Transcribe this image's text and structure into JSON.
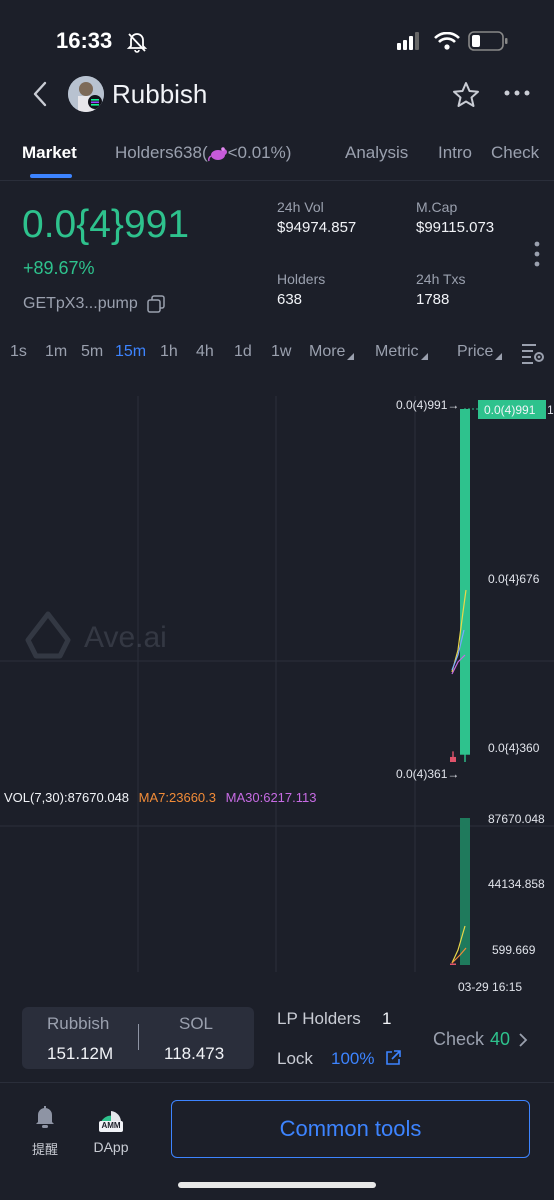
{
  "status_bar": {
    "time": "16:33"
  },
  "header": {
    "title": "Rubbish"
  },
  "tabs": [
    {
      "label": "Market"
    },
    {
      "label": "Holders638("
    },
    {
      "label": "<0.01%)"
    },
    {
      "label": "Analysis"
    },
    {
      "label": "Intro"
    },
    {
      "label": "Check"
    }
  ],
  "token": {
    "price": "0.0{4}991",
    "change": "+89.67%",
    "address": "GETpX3...pump"
  },
  "stats": {
    "vol_label": "24h Vol",
    "vol_value": "$94974.857",
    "mcap_label": "M.Cap",
    "mcap_value": "$99115.073",
    "holders_label": "Holders",
    "holders_value": "638",
    "txs_label": "24h Txs",
    "txs_value": "1788"
  },
  "timeframes": [
    "1s",
    "1m",
    "5m",
    "15m",
    "1h",
    "4h",
    "1d",
    "1w"
  ],
  "active_timeframe": "15m",
  "toolbar": {
    "more": "More",
    "metric": "Metric",
    "price": "Price"
  },
  "chart": {
    "watermark": "Ave.ai",
    "high_marker": "0.0(4)991→",
    "low_marker": "0.0(4)361→",
    "price_tag": "0.0(4)991",
    "price_tag_suffix": "1",
    "y_labels": [
      "0.0{4}676",
      "0.0{4}360"
    ],
    "vol_info": "VOL(7,30):87670.048",
    "ma7": "MA7:23660.3",
    "ma30": "MA30:6217.113",
    "vol_labels": [
      "87670.048",
      "44134.858",
      "599.669"
    ],
    "x_label": "03-29 16:15",
    "colors": {
      "up": "#2ec28d",
      "down": "#e0536b",
      "ma7": "#f28c38",
      "ma30": "#c66be3"
    }
  },
  "chart_data": {
    "type": "candlestick",
    "candles": [
      {
        "open": 3.61e-05,
        "high": 3.8e-05,
        "low": 3.61e-05,
        "close": 3.7e-05
      },
      {
        "open": 3.74e-05,
        "high": 9.91e-05,
        "low": 3.61e-05,
        "close": 9.91e-05
      }
    ],
    "volume": [
      900,
      87670.048
    ],
    "y_ticks": [
      "0.0{4}676",
      "0.0{4}360"
    ],
    "x_label": "03-29 16:15"
  },
  "pair": {
    "base_label": "Rubbish",
    "base_value": "151.12M",
    "quote_label": "SOL",
    "quote_value": "118.473"
  },
  "lp": {
    "holders_label": "LP Holders",
    "holders_value": "1",
    "lock_label": "Lock",
    "lock_value": "100%",
    "check_label": "Check",
    "check_value": "40"
  },
  "bottom_nav": {
    "alerts_label": "提醒",
    "dapp_label": "DApp",
    "amm_badge": "AMM",
    "tools_label": "Common tools"
  }
}
